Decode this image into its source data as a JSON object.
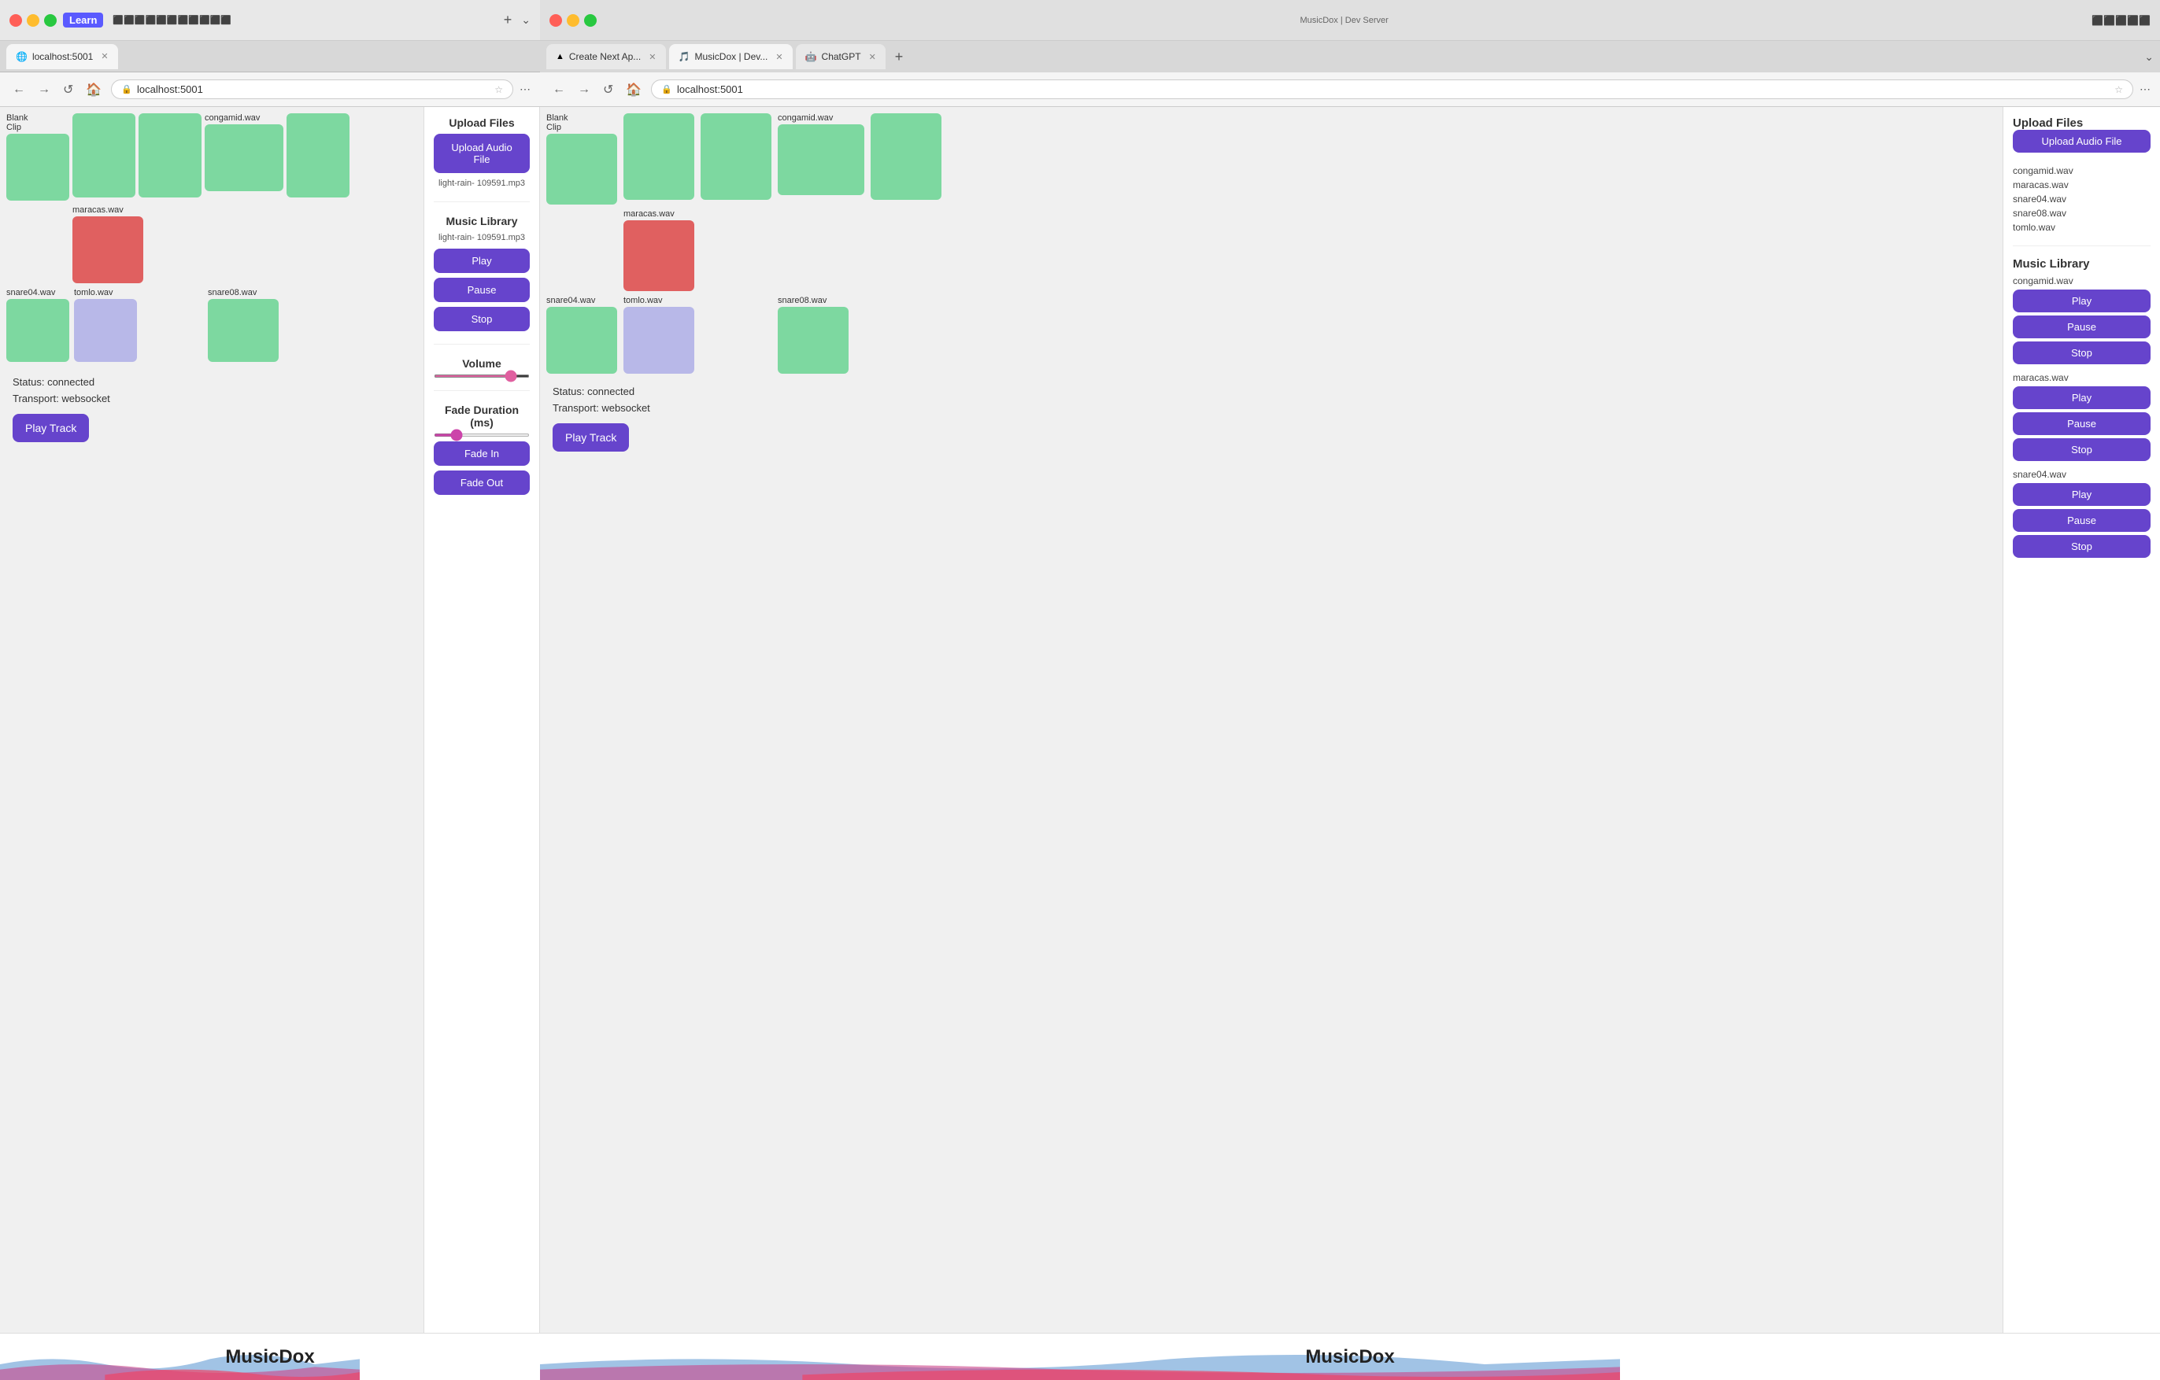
{
  "leftBrowser": {
    "titlebar": {
      "trafficLights": [
        "close",
        "minimize",
        "maximize"
      ],
      "learnBadge": "Learn",
      "icons": [
        "◀◀",
        "▶▶",
        "⊕",
        "⊞",
        "☆",
        "🔗",
        "⚙"
      ]
    },
    "tabs": [
      {
        "label": "localhost:5001",
        "active": true,
        "icon": "🌐"
      }
    ],
    "addressBar": {
      "url": "localhost:5001",
      "buttons": [
        "←",
        "→",
        "↺",
        "🏠"
      ]
    },
    "drumPads": {
      "row1": [
        {
          "label": "Blank\nClip",
          "color": "green",
          "width": 90
        },
        {
          "label": "",
          "color": "green",
          "width": 90
        },
        {
          "label": "",
          "color": "green",
          "width": 90
        },
        {
          "label": "congamid.wav",
          "color": "green",
          "width": 110
        },
        {
          "label": "",
          "color": "green",
          "width": 90
        }
      ],
      "row2": [
        {
          "label": "",
          "color": "white",
          "width": 90
        },
        {
          "label": "maracas.wav",
          "color": "red",
          "width": 100
        },
        {
          "label": "",
          "color": "white",
          "width": 90
        },
        {
          "label": "",
          "color": "white",
          "width": 90
        },
        {
          "label": "",
          "color": "white",
          "width": 90
        }
      ],
      "row3": [
        {
          "label": "snare04.wav",
          "color": "green",
          "width": 90
        },
        {
          "label": "tomlo.wav",
          "color": "lavender",
          "width": 90
        },
        {
          "label": "",
          "color": "white",
          "width": 90
        },
        {
          "label": "snare08.wav",
          "color": "green",
          "width": 90
        },
        {
          "label": "",
          "color": "white",
          "width": 90
        }
      ]
    },
    "status": {
      "connected": "Status: connected",
      "transport": "Transport: websocket"
    },
    "playTrackBtn": "Play Track",
    "footer": {
      "brand": "MusicDox"
    }
  },
  "centerPanel": {
    "uploadSection": {
      "title": "Upload Files",
      "btnLabel": "Upload Audio\nFile",
      "currentFile": "light-rain-\n109591.mp3"
    },
    "musicLibrary": {
      "title": "Music Library",
      "currentFile": "light-rain-\n109591.mp3",
      "playBtn": "Play",
      "pauseBtn": "Pause",
      "stopBtn": "Stop"
    },
    "volume": {
      "title": "Volume",
      "value": 85
    },
    "fadeDuration": {
      "title": "Fade Duration\n(ms)",
      "value": 20,
      "fadeInBtn": "Fade In",
      "fadeOutBtn": "Fade Out"
    }
  },
  "rightBrowser": {
    "titlebar": {
      "trafficLights": [
        "close-inactive",
        "minimize-inactive",
        "maximize-inactive"
      ]
    },
    "tabs": [
      {
        "label": "Create Next Ap...",
        "active": false,
        "icon": "▲",
        "color": "#000"
      },
      {
        "label": "MusicDox | Dev...",
        "active": true,
        "icon": "🎵"
      },
      {
        "label": "ChatGPT",
        "active": false,
        "icon": "🤖"
      }
    ],
    "addressBar": {
      "url": "localhost:5001"
    },
    "drumPads": {
      "row1": [
        {
          "label": "Blank\nClip",
          "color": "green"
        },
        {
          "label": "",
          "color": "green"
        },
        {
          "label": "",
          "color": "green"
        },
        {
          "label": "congamid.wav",
          "color": "green"
        },
        {
          "label": "",
          "color": "green"
        }
      ],
      "row2": [
        {
          "label": "",
          "color": "white"
        },
        {
          "label": "maracas.wav",
          "color": "red"
        },
        {
          "label": "",
          "color": "white"
        },
        {
          "label": "",
          "color": "white"
        },
        {
          "label": "",
          "color": "white"
        }
      ],
      "row3": [
        {
          "label": "snare04.wav",
          "color": "green"
        },
        {
          "label": "tomlo.wav",
          "color": "lavender"
        },
        {
          "label": "",
          "color": "white"
        },
        {
          "label": "snare08.wav",
          "color": "green"
        },
        {
          "label": "",
          "color": "white"
        }
      ]
    },
    "status": {
      "connected": "Status: connected",
      "transport": "Transport: websocket"
    },
    "playTrackBtn": "Play Track",
    "sidePanel": {
      "uploadTitle": "Upload Files",
      "uploadBtn": "Upload Audio\nFile",
      "files": [
        "congamid.wav",
        "maracas.wav",
        "snare04.wav",
        "snare08.wav",
        "tomlo.wav"
      ],
      "musicLibTitle": "Music Library",
      "tracks": [
        {
          "name": "congamid.wav",
          "play": "Play",
          "pause": "Pause",
          "stop": "Stop"
        },
        {
          "name": "maracas.wav",
          "play": "Play",
          "pause": "Pause",
          "stop": "Stop"
        },
        {
          "name": "snare04.wav",
          "play": "Play",
          "pause": "Pause",
          "stop": "Stop"
        }
      ]
    },
    "footer": {
      "brand": "MusicDox"
    }
  }
}
